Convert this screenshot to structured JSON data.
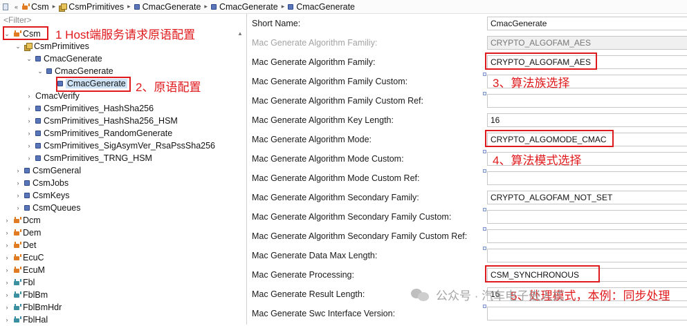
{
  "breadcrumb": [
    "Csm",
    "CsmPrimitives",
    "CmacGenerate",
    "CmacGenerate",
    "CmacGenerate"
  ],
  "tree": {
    "filter_placeholder": "<Filter>",
    "nodes": [
      {
        "label": "Csm",
        "icon": "module-icon",
        "expand": "open"
      },
      {
        "label": "CsmPrimitives",
        "icon": "container-icon",
        "expand": "open"
      },
      {
        "label": "CmacGenerate",
        "icon": "config-icon",
        "expand": "open"
      },
      {
        "label": "CmacGenerate",
        "icon": "config-icon",
        "expand": "open"
      },
      {
        "label": "CmacGenerate",
        "icon": "config-icon",
        "expand": "none",
        "selected": true
      },
      {
        "label": "CmacVerify",
        "icon": "",
        "expand": "closed"
      },
      {
        "label": "CsmPrimitives_HashSha256",
        "icon": "config-icon",
        "expand": "closed"
      },
      {
        "label": "CsmPrimitives_HashSha256_HSM",
        "icon": "config-icon",
        "expand": "closed"
      },
      {
        "label": "CsmPrimitives_RandomGenerate",
        "icon": "config-icon",
        "expand": "closed"
      },
      {
        "label": "CsmPrimitives_SigAsymVer_RsaPssSha256",
        "icon": "config-icon",
        "expand": "closed"
      },
      {
        "label": "CsmPrimitives_TRNG_HSM",
        "icon": "config-icon",
        "expand": "closed"
      },
      {
        "label": "CsmGeneral",
        "icon": "config-icon",
        "expand": "closed"
      },
      {
        "label": "CsmJobs",
        "icon": "config-icon",
        "expand": "closed"
      },
      {
        "label": "CsmKeys",
        "icon": "config-icon",
        "expand": "closed"
      },
      {
        "label": "CsmQueues",
        "icon": "config-icon",
        "expand": "closed"
      },
      {
        "label": "Dcm",
        "icon": "module-icon",
        "expand": "closed"
      },
      {
        "label": "Dem",
        "icon": "module-icon",
        "expand": "closed"
      },
      {
        "label": "Det",
        "icon": "module-icon",
        "expand": "closed"
      },
      {
        "label": "EcuC",
        "icon": "module-icon",
        "expand": "closed"
      },
      {
        "label": "EcuM",
        "icon": "module-icon",
        "expand": "closed"
      },
      {
        "label": "Fbl",
        "icon": "module-icon-teal",
        "expand": "closed"
      },
      {
        "label": "FblBm",
        "icon": "module-icon-teal",
        "expand": "closed"
      },
      {
        "label": "FblBmHdr",
        "icon": "module-icon-teal",
        "expand": "closed"
      },
      {
        "label": "FblHal",
        "icon": "module-icon-teal",
        "expand": "closed"
      }
    ]
  },
  "annotations": {
    "a1": "1 Host端服务请求原语配置",
    "a2": "2、原语配置",
    "a3": "3、算法族选择",
    "a4": "4、算法模式选择",
    "a5": "5、处理模式，本例：同步处理",
    "color": "#e0191c"
  },
  "properties": [
    {
      "label": "Short Name:",
      "value": "CmacGenerate",
      "disabled": false
    },
    {
      "label": "Mac Generate Algorithm Familiy:",
      "value": "CRYPTO_ALGOFAM_AES",
      "disabled": true
    },
    {
      "label": "Mac Generate Algorithm Family:",
      "value": "CRYPTO_ALGOFAM_AES",
      "disabled": false
    },
    {
      "label": "Mac Generate Algorithm Family Custom:",
      "value": "",
      "disabled": false
    },
    {
      "label": "Mac Generate Algorithm Family Custom Ref:",
      "value": "",
      "disabled": false
    },
    {
      "label": "Mac Generate Algorithm Key Length:",
      "value": "16",
      "disabled": false
    },
    {
      "label": "Mac Generate Algorithm Mode:",
      "value": "CRYPTO_ALGOMODE_CMAC",
      "disabled": false
    },
    {
      "label": "Mac Generate Algorithm Mode Custom:",
      "value": "",
      "disabled": false
    },
    {
      "label": "Mac Generate Algorithm Mode Custom Ref:",
      "value": "",
      "disabled": false
    },
    {
      "label": "Mac Generate Algorithm Secondary Family:",
      "value": "CRYPTO_ALGOFAM_NOT_SET",
      "disabled": false
    },
    {
      "label": "Mac Generate Algorithm Secondary Family Custom:",
      "value": "",
      "disabled": false
    },
    {
      "label": "Mac Generate Algorithm Secondary Family Custom Ref:",
      "value": "",
      "disabled": false
    },
    {
      "label": "Mac Generate Data Max Length:",
      "value": "",
      "disabled": false
    },
    {
      "label": "Mac Generate Processing:",
      "value": "CSM_SYNCHRONOUS",
      "disabled": false
    },
    {
      "label": "Mac Generate Result Length:",
      "value": "16",
      "disabled": false
    },
    {
      "label": "Mac Generate Swc Interface Version:",
      "value": "",
      "disabled": false
    }
  ],
  "watermark": "公众号 · 汽车电子嵌入式"
}
